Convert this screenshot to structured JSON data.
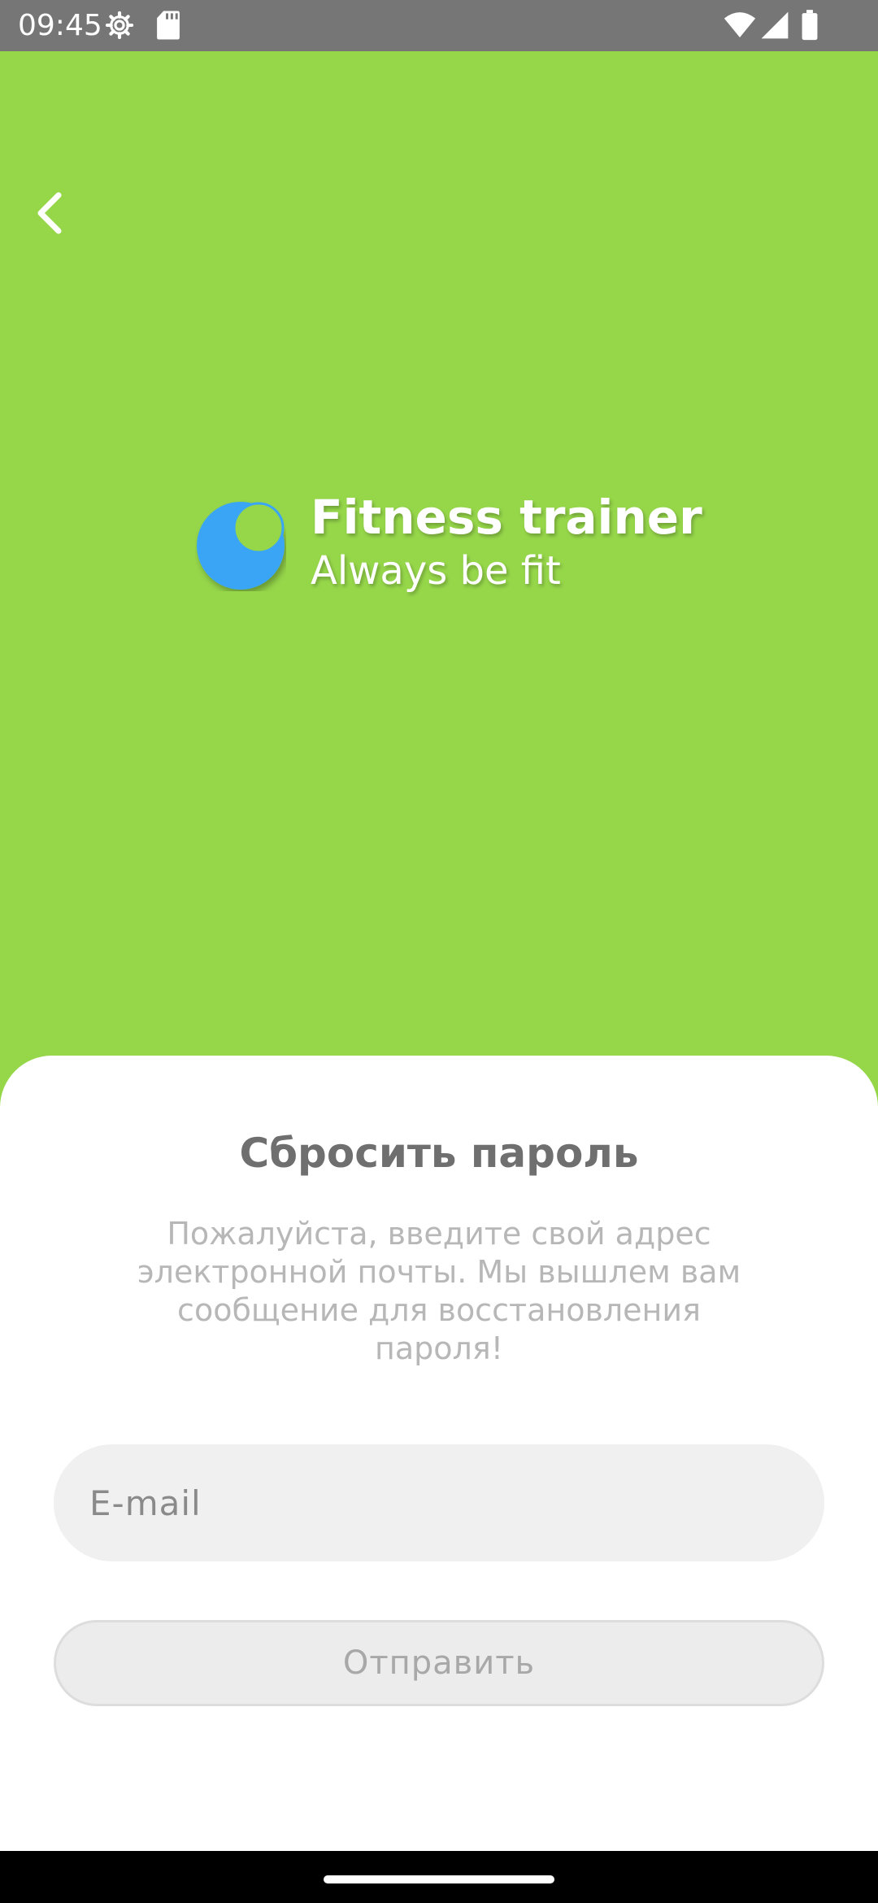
{
  "status_bar": {
    "time": "09:45",
    "icons": [
      "gear-icon",
      "sd-card-icon",
      "wifi-icon",
      "signal-icon",
      "battery-icon"
    ]
  },
  "header": {
    "back_icon": "chevron-left-icon",
    "app_title": "Fitness trainer",
    "app_subtitle": "Always be fit",
    "logo_icon": "moon-logo-icon"
  },
  "reset": {
    "title": "Сбросить пароль",
    "description": "Пожалуйста, введите свой адрес электронной почты. Мы вышлем вам сообщение для восстановления пароля!",
    "email_value": "",
    "email_placeholder": "E-mail",
    "submit_label": "Отправить"
  },
  "colors": {
    "brand_green": "#96d74a",
    "logo_blue": "#3ba5f5",
    "status_bar": "#767676",
    "title_gray": "#6f6f6f",
    "desc_gray": "#b7b7b7",
    "field_bg": "#f0f0f0"
  }
}
